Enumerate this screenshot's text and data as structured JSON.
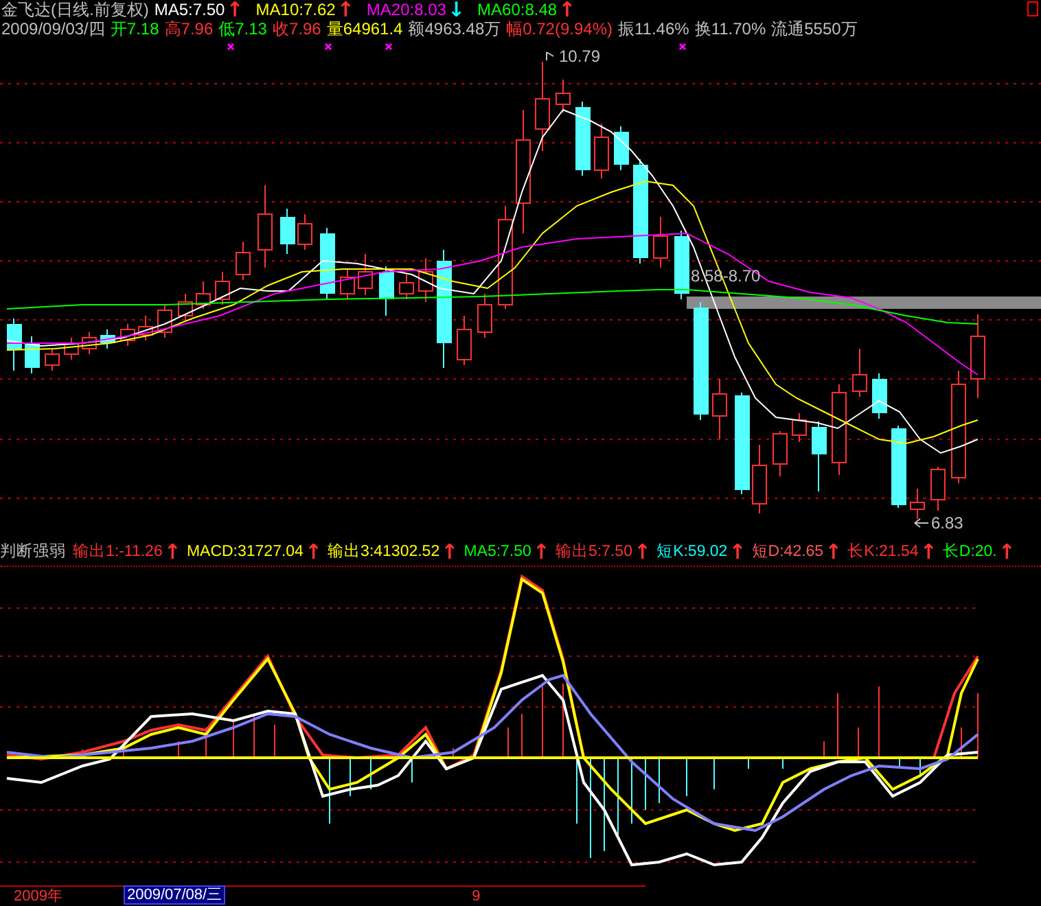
{
  "header": {
    "title": "金飞达(日线.前复权)",
    "averages": [
      {
        "label": "MA5:7.50",
        "color": "#ffffff",
        "arrow": {
          "text": "↑",
          "color": "#ff3232"
        }
      },
      {
        "label": "MA10:7.62",
        "color": "#ffff00",
        "arrow": {
          "text": "↑",
          "color": "#ff3232"
        }
      },
      {
        "label": "MA20:8.03",
        "color": "#ff00ff",
        "arrow": {
          "text": "↓",
          "color": "#00ffff"
        }
      },
      {
        "label": "MA60:8.48",
        "color": "#00ff00",
        "arrow": {
          "text": "↑",
          "color": "#ff3232"
        }
      }
    ]
  },
  "quote": [
    {
      "text": "2009/09/03/四",
      "color": "#c0c0c0"
    },
    {
      "text": "开7.18",
      "color": "#00ff00"
    },
    {
      "text": "高7.96",
      "color": "#ff3232"
    },
    {
      "text": "低7.13",
      "color": "#00ff00"
    },
    {
      "text": "收7.96",
      "color": "#ff3232"
    },
    {
      "text": "量64961.4",
      "color": "#ffff00"
    },
    {
      "text": "额4963.48万",
      "color": "#c0c0c0"
    },
    {
      "text": "幅0.72(9.94%)",
      "color": "#ff3232"
    },
    {
      "text": "振11.46%",
      "color": "#c0c0c0"
    },
    {
      "text": "换11.70%",
      "color": "#c0c0c0"
    },
    {
      "text": "流通5550万",
      "color": "#c0c0c0"
    }
  ],
  "main_chart": {
    "high_label": "10.79",
    "range_label": "8.58-8.70",
    "low_label": "6.83"
  },
  "indicator": {
    "name": "判断强弱",
    "series": [
      {
        "label": "输出1:-11.26",
        "color": "#ff3232",
        "arrow": {
          "text": "↑",
          "color": "#ff3232"
        }
      },
      {
        "label": "MACD:31727.04",
        "color": "#ffff00",
        "arrow": {
          "text": "↑",
          "color": "#ff3232"
        }
      },
      {
        "label": "输出3:41302.52",
        "color": "#ffff00",
        "arrow": {
          "text": "↑",
          "color": "#ff3232"
        }
      },
      {
        "label": "MA5:7.50",
        "color": "#00ff00",
        "arrow": {
          "text": "↑",
          "color": "#ff3232"
        }
      },
      {
        "label": "输出5:7.50",
        "color": "#ff3232",
        "arrow": {
          "text": "↑",
          "color": "#ff3232"
        }
      },
      {
        "label": "短K:59.02",
        "color": "#00ffff",
        "arrow": {
          "text": "↑",
          "color": "#ff3232"
        }
      },
      {
        "label": "短D:42.65",
        "color": "#ff5a5a",
        "arrow": {
          "text": "↑",
          "color": "#ff3232"
        }
      },
      {
        "label": "长K:21.54",
        "color": "#ff3232",
        "arrow": {
          "text": "↑",
          "color": "#ff3232"
        }
      },
      {
        "label": "长D:20.",
        "color": "#00ff00",
        "arrow": {
          "text": "↑",
          "color": "#ff3232"
        }
      }
    ]
  },
  "date_axis": [
    {
      "text": "2009年",
      "selected": false
    },
    {
      "text": "2009/07/08/三",
      "selected": true
    },
    {
      "text": "9",
      "selected": false
    }
  ]
}
